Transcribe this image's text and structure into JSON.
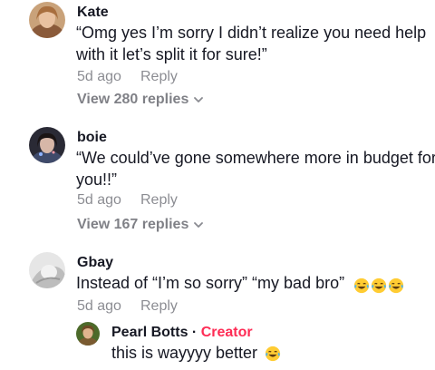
{
  "comments": [
    {
      "username": "Kate",
      "text_line1": "“Omg yes I’m sorry I didn’t realize you need help",
      "text_line2": "with it let’s split it for sure!”",
      "time": "5d ago",
      "reply": "Reply",
      "view_replies": "View 280 replies"
    },
    {
      "username": "boie",
      "text_line1": "“We could’ve gone somewhere more in budget for",
      "text_line2": "you!!”",
      "time": "5d ago",
      "reply": "Reply",
      "view_replies": "View 167 replies"
    },
    {
      "username": "Gbay",
      "text_line1": "Instead of “I’m so sorry” “my bad bro”",
      "emoji": "face-with-tears-of-joy-icon",
      "emoji_count": 3,
      "time": "5d ago",
      "reply": "Reply"
    }
  ],
  "reply": {
    "username": "Pearl Botts",
    "separator": "·",
    "badge": "Creator",
    "text": "this is wayyyy better",
    "emoji": "face-with-tears-of-joy-icon"
  },
  "colors": {
    "primary_text": "#161823",
    "secondary_text": "#8a8b91",
    "creator_badge": "#fe2c55"
  }
}
